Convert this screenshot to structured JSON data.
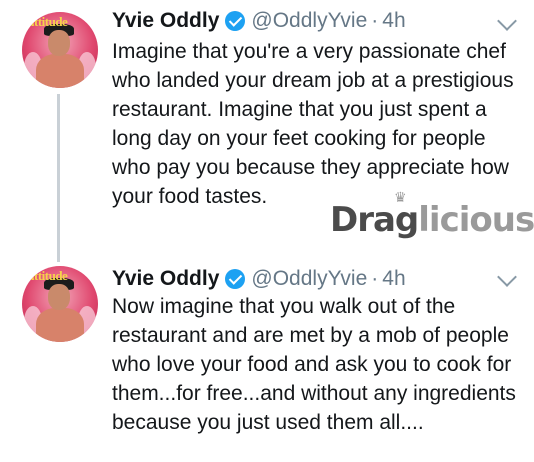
{
  "tweets": [
    {
      "name": "Yvie Oddly",
      "handle": "@OddlyYvie",
      "separator": "·",
      "time": "4h",
      "avatar_text": "attitude",
      "text": "Imagine that you're a very passionate chef who landed your dream job at a prestigious restaurant. Imagine that you just spent a long day on your feet cooking for people who pay you because they appreciate how your food tastes."
    },
    {
      "name": "Yvie Oddly",
      "handle": "@OddlyYvie",
      "separator": "·",
      "time": "4h",
      "avatar_text": "attitude",
      "text": "Now imagine that you walk out of the restaurant and are met by a mob of people who love your food and ask you to cook for them...for free...and without any ingredients because you just used them all...."
    }
  ],
  "watermark": {
    "part1": "Drag",
    "part2": "licious"
  },
  "colors": {
    "verified": "#1da1f2",
    "secondary_text": "#657786",
    "thread_line": "#c9d0d6"
  },
  "icons": [
    "verified-badge-icon",
    "chevron-down-icon"
  ]
}
